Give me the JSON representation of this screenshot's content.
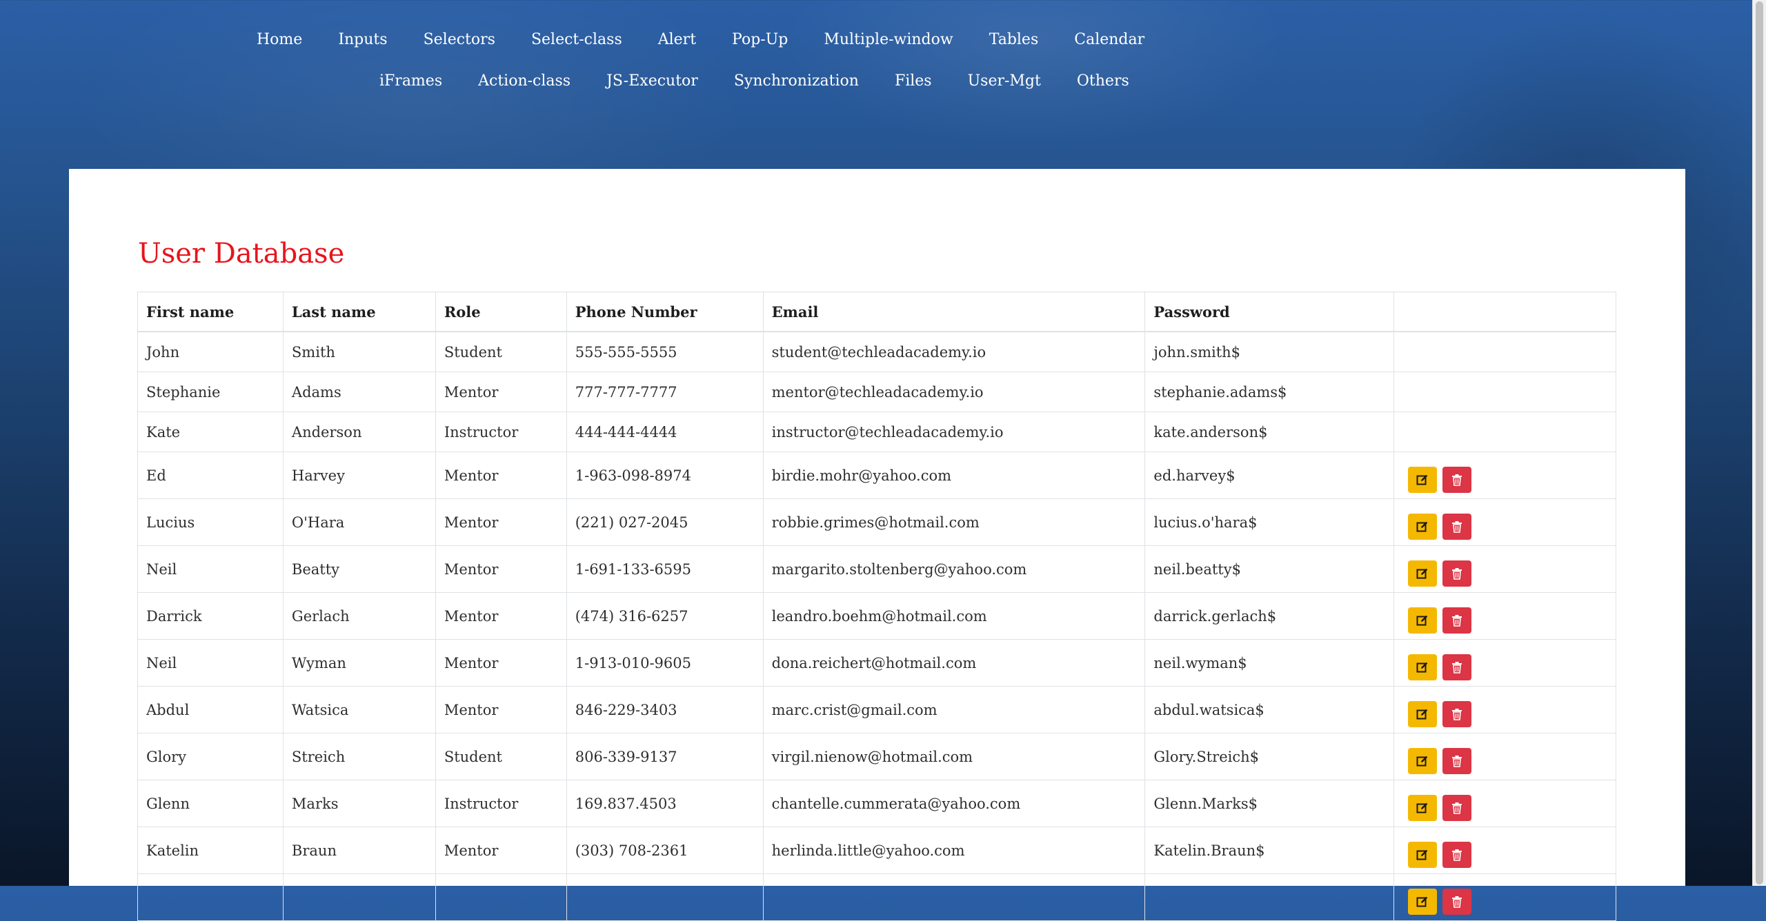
{
  "nav": {
    "row1": [
      "Home",
      "Inputs",
      "Selectors",
      "Select-class",
      "Alert",
      "Pop-Up",
      "Multiple-window",
      "Tables",
      "Calendar"
    ],
    "row2": [
      "iFrames",
      "Action-class",
      "JS-Executor",
      "Synchronization",
      "Files",
      "User-Mgt",
      "Others"
    ]
  },
  "page_title": "User Database",
  "table": {
    "headers": [
      "First name",
      "Last name",
      "Role",
      "Phone Number",
      "Email",
      "Password",
      ""
    ],
    "rows": [
      {
        "first": "John",
        "last": "Smith",
        "role": "Student",
        "phone": "555-555-5555",
        "email": "student@techleadacademy.io",
        "password": "john.smith$",
        "actions": false
      },
      {
        "first": "Stephanie",
        "last": "Adams",
        "role": "Mentor",
        "phone": "777-777-7777",
        "email": "mentor@techleadacademy.io",
        "password": "stephanie.adams$",
        "actions": false
      },
      {
        "first": "Kate",
        "last": "Anderson",
        "role": "Instructor",
        "phone": "444-444-4444",
        "email": "instructor@techleadacademy.io",
        "password": "kate.anderson$",
        "actions": false
      },
      {
        "first": "Ed",
        "last": "Harvey",
        "role": "Mentor",
        "phone": "1-963-098-8974",
        "email": "birdie.mohr@yahoo.com",
        "password": "ed.harvey$",
        "actions": true
      },
      {
        "first": "Lucius",
        "last": "O'Hara",
        "role": "Mentor",
        "phone": "(221) 027-2045",
        "email": "robbie.grimes@hotmail.com",
        "password": "lucius.o'hara$",
        "actions": true
      },
      {
        "first": "Neil",
        "last": "Beatty",
        "role": "Mentor",
        "phone": "1-691-133-6595",
        "email": "margarito.stoltenberg@yahoo.com",
        "password": "neil.beatty$",
        "actions": true
      },
      {
        "first": "Darrick",
        "last": "Gerlach",
        "role": "Mentor",
        "phone": "(474) 316-6257",
        "email": "leandro.boehm@hotmail.com",
        "password": "darrick.gerlach$",
        "actions": true
      },
      {
        "first": "Neil",
        "last": "Wyman",
        "role": "Mentor",
        "phone": "1-913-010-9605",
        "email": "dona.reichert@hotmail.com",
        "password": "neil.wyman$",
        "actions": true
      },
      {
        "first": "Abdul",
        "last": "Watsica",
        "role": "Mentor",
        "phone": "846-229-3403",
        "email": "marc.crist@gmail.com",
        "password": "abdul.watsica$",
        "actions": true
      },
      {
        "first": "Glory",
        "last": "Streich",
        "role": "Student",
        "phone": "806-339-9137",
        "email": "virgil.nienow@hotmail.com",
        "password": "Glory.Streich$",
        "actions": true
      },
      {
        "first": "Glenn",
        "last": "Marks",
        "role": "Instructor",
        "phone": "169.837.4503",
        "email": "chantelle.cummerata@yahoo.com",
        "password": "Glenn.Marks$",
        "actions": true
      },
      {
        "first": "Katelin",
        "last": "Braun",
        "role": "Mentor",
        "phone": "(303) 708-2361",
        "email": "herlinda.little@yahoo.com",
        "password": "Katelin.Braun$",
        "actions": true
      },
      {
        "first": "",
        "last": "",
        "role": "",
        "phone": "",
        "email": "",
        "password": "",
        "actions": true
      }
    ]
  },
  "icons": {
    "edit": "edit-icon",
    "delete": "trash-icon"
  },
  "colors": {
    "title": "#e8141c",
    "edit_button": "#f5b800",
    "delete_button": "#dc3545"
  }
}
